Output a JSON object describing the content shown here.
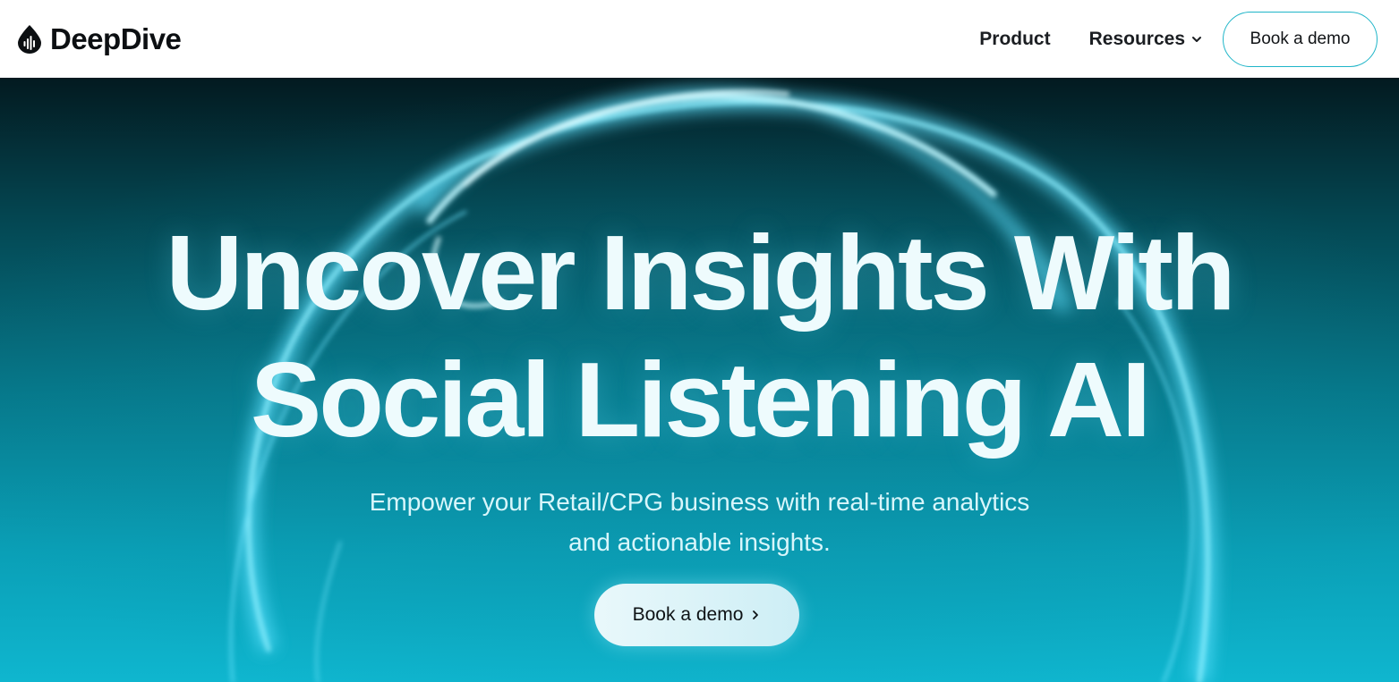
{
  "header": {
    "brand_name": "DeepDive",
    "nav": {
      "product_label": "Product",
      "resources_label": "Resources",
      "cta_label": "Book a demo"
    }
  },
  "hero": {
    "title_line1": "Uncover Insights With",
    "title_line2": "Social Listening AI",
    "subtitle_line1": "Empower your Retail/CPG business with real-time analytics",
    "subtitle_line2": "and actionable insights.",
    "cta_label": "Book a demo"
  },
  "icons": {
    "logo": "droplet-waveform-icon",
    "resources_dropdown": "chevron-down-icon",
    "cta_arrow": "chevron-right-icon"
  },
  "colors": {
    "accent_border": "#1fb5c8",
    "hero_top": "#031a20",
    "hero_bottom": "#0fb6cf",
    "hero_text": "#eefbfd",
    "header_bg": "#ffffff"
  }
}
